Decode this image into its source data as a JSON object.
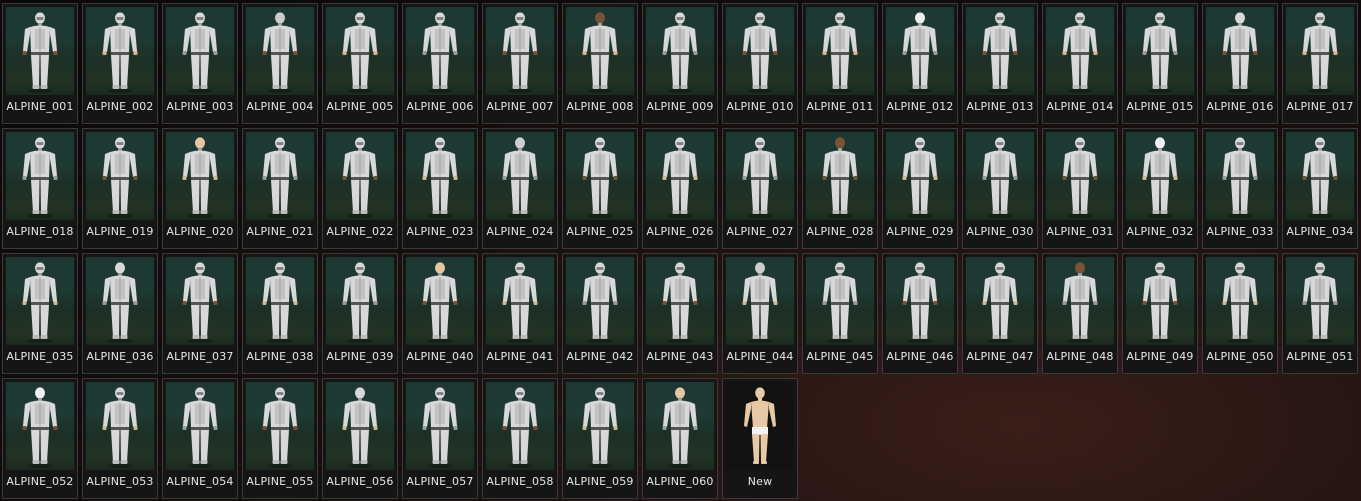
{
  "window_title": "",
  "outfits": [
    {
      "label": "ALPINE_001",
      "icon": "outfit-figure-icon"
    },
    {
      "label": "ALPINE_002",
      "icon": "outfit-figure-icon"
    },
    {
      "label": "ALPINE_003",
      "icon": "outfit-figure-icon"
    },
    {
      "label": "ALPINE_004",
      "icon": "outfit-figure-icon"
    },
    {
      "label": "ALPINE_005",
      "icon": "outfit-figure-icon"
    },
    {
      "label": "ALPINE_006",
      "icon": "outfit-figure-icon"
    },
    {
      "label": "ALPINE_007",
      "icon": "outfit-figure-icon"
    },
    {
      "label": "ALPINE_008",
      "icon": "outfit-figure-icon"
    },
    {
      "label": "ALPINE_009",
      "icon": "outfit-figure-icon"
    },
    {
      "label": "ALPINE_010",
      "icon": "outfit-figure-icon"
    },
    {
      "label": "ALPINE_011",
      "icon": "outfit-figure-icon"
    },
    {
      "label": "ALPINE_012",
      "icon": "outfit-figure-icon"
    },
    {
      "label": "ALPINE_013",
      "icon": "outfit-figure-icon"
    },
    {
      "label": "ALPINE_014",
      "icon": "outfit-figure-icon"
    },
    {
      "label": "ALPINE_015",
      "icon": "outfit-figure-icon"
    },
    {
      "label": "ALPINE_016",
      "icon": "outfit-figure-icon"
    },
    {
      "label": "ALPINE_017",
      "icon": "outfit-figure-icon"
    },
    {
      "label": "ALPINE_018",
      "icon": "outfit-figure-icon"
    },
    {
      "label": "ALPINE_019",
      "icon": "outfit-figure-icon"
    },
    {
      "label": "ALPINE_020",
      "icon": "outfit-figure-icon"
    },
    {
      "label": "ALPINE_021",
      "icon": "outfit-figure-icon"
    },
    {
      "label": "ALPINE_022",
      "icon": "outfit-figure-icon"
    },
    {
      "label": "ALPINE_023",
      "icon": "outfit-figure-icon"
    },
    {
      "label": "ALPINE_024",
      "icon": "outfit-figure-icon"
    },
    {
      "label": "ALPINE_025",
      "icon": "outfit-figure-icon"
    },
    {
      "label": "ALPINE_026",
      "icon": "outfit-figure-icon"
    },
    {
      "label": "ALPINE_027",
      "icon": "outfit-figure-icon"
    },
    {
      "label": "ALPINE_028",
      "icon": "outfit-figure-icon"
    },
    {
      "label": "ALPINE_029",
      "icon": "outfit-figure-icon"
    },
    {
      "label": "ALPINE_030",
      "icon": "outfit-figure-icon"
    },
    {
      "label": "ALPINE_031",
      "icon": "outfit-figure-icon"
    },
    {
      "label": "ALPINE_032",
      "icon": "outfit-figure-icon"
    },
    {
      "label": "ALPINE_033",
      "icon": "outfit-figure-icon"
    },
    {
      "label": "ALPINE_034",
      "icon": "outfit-figure-icon"
    },
    {
      "label": "ALPINE_035",
      "icon": "outfit-figure-icon"
    },
    {
      "label": "ALPINE_036",
      "icon": "outfit-figure-icon"
    },
    {
      "label": "ALPINE_037",
      "icon": "outfit-figure-icon"
    },
    {
      "label": "ALPINE_038",
      "icon": "outfit-figure-icon"
    },
    {
      "label": "ALPINE_039",
      "icon": "outfit-figure-icon"
    },
    {
      "label": "ALPINE_040",
      "icon": "outfit-figure-icon"
    },
    {
      "label": "ALPINE_041",
      "icon": "outfit-figure-icon"
    },
    {
      "label": "ALPINE_042",
      "icon": "outfit-figure-icon"
    },
    {
      "label": "ALPINE_043",
      "icon": "outfit-figure-icon"
    },
    {
      "label": "ALPINE_044",
      "icon": "outfit-figure-icon"
    },
    {
      "label": "ALPINE_045",
      "icon": "outfit-figure-icon"
    },
    {
      "label": "ALPINE_046",
      "icon": "outfit-figure-icon"
    },
    {
      "label": "ALPINE_047",
      "icon": "outfit-figure-icon"
    },
    {
      "label": "ALPINE_048",
      "icon": "outfit-figure-icon"
    },
    {
      "label": "ALPINE_049",
      "icon": "outfit-figure-icon"
    },
    {
      "label": "ALPINE_050",
      "icon": "outfit-figure-icon"
    },
    {
      "label": "ALPINE_051",
      "icon": "outfit-figure-icon"
    },
    {
      "label": "ALPINE_052",
      "icon": "outfit-figure-icon"
    },
    {
      "label": "ALPINE_053",
      "icon": "outfit-figure-icon"
    },
    {
      "label": "ALPINE_054",
      "icon": "outfit-figure-icon"
    },
    {
      "label": "ALPINE_055",
      "icon": "outfit-figure-icon"
    },
    {
      "label": "ALPINE_056",
      "icon": "outfit-figure-icon"
    },
    {
      "label": "ALPINE_057",
      "icon": "outfit-figure-icon"
    },
    {
      "label": "ALPINE_058",
      "icon": "outfit-figure-icon"
    },
    {
      "label": "ALPINE_059",
      "icon": "outfit-figure-icon"
    },
    {
      "label": "ALPINE_060",
      "icon": "outfit-figure-icon"
    }
  ],
  "new_tile": {
    "label": "New",
    "icon": "new-character-icon"
  },
  "colors": {
    "suit": "#d8d8d8",
    "suit_shade": "#9c9c9c",
    "skin_light": "#e6c6a0",
    "skin_dark": "#7a5236",
    "new_body": "#e8c9a6",
    "new_shorts": "#f2f2f2"
  }
}
